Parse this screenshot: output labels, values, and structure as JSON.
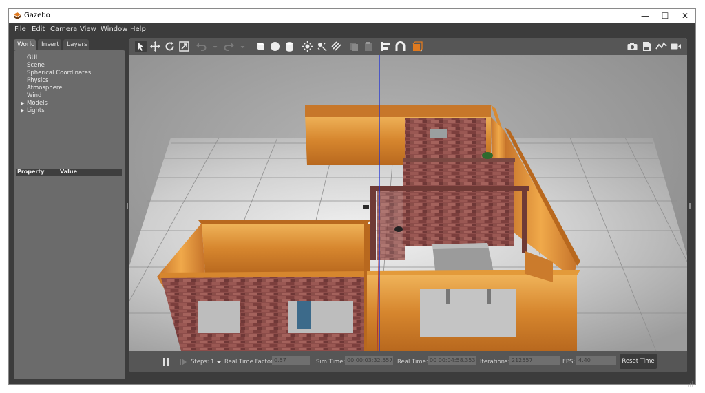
{
  "window": {
    "title": "Gazebo",
    "minimize_glyph": "—",
    "maximize_glyph": "☐",
    "close_glyph": "✕"
  },
  "menu": [
    "File",
    "Edit",
    "Camera",
    "View",
    "Window",
    "Help"
  ],
  "left_tabs": [
    "World",
    "Insert",
    "Layers"
  ],
  "world_tree": [
    {
      "label": "GUI",
      "expandable": false
    },
    {
      "label": "Scene",
      "expandable": false
    },
    {
      "label": "Spherical Coordinates",
      "expandable": false
    },
    {
      "label": "Physics",
      "expandable": false
    },
    {
      "label": "Atmosphere",
      "expandable": false
    },
    {
      "label": "Wind",
      "expandable": false
    },
    {
      "label": "Models",
      "expandable": true
    },
    {
      "label": "Lights",
      "expandable": true
    }
  ],
  "property_table": {
    "col_property": "Property",
    "col_value": "Value"
  },
  "toolbar_icons": [
    "select-mode-icon",
    "translate-mode-icon",
    "rotate-mode-icon",
    "scale-mode-icon",
    "undo-icon",
    "undo-history-icon",
    "redo-icon",
    "redo-history-icon",
    "box-shape-icon",
    "sphere-shape-icon",
    "cylinder-shape-icon",
    "point-light-icon",
    "spot-light-icon",
    "directional-light-icon",
    "copy-icon",
    "paste-icon",
    "align-icon",
    "snap-icon",
    "change-view-icon",
    "screenshot-icon",
    "log-icon",
    "plot-icon",
    "video-record-icon"
  ],
  "bottom": {
    "steps_label": "Steps:",
    "steps_value": "1",
    "rtf_label": "Real Time Factor:",
    "rtf_value": "0.57",
    "sim_time_label": "Sim Time:",
    "sim_time_value": "00 00:03:32.557",
    "real_time_label": "Real Time:",
    "real_time_value": "00 00:04:58.353",
    "iterations_label": "Iterations:",
    "iterations_value": "212557",
    "fps_label": "FPS:",
    "fps_value": "4.40",
    "reset_label": "Reset Time"
  },
  "colors": {
    "panel_bg": "#6b6b6b",
    "window_bg": "#3c3c3c",
    "toolbar_bg": "#565656",
    "viewport_bg": "#8a8a8a",
    "wood": "#d98a32",
    "brick": "#8a4a46",
    "z_axis": "#1b2fd6"
  }
}
